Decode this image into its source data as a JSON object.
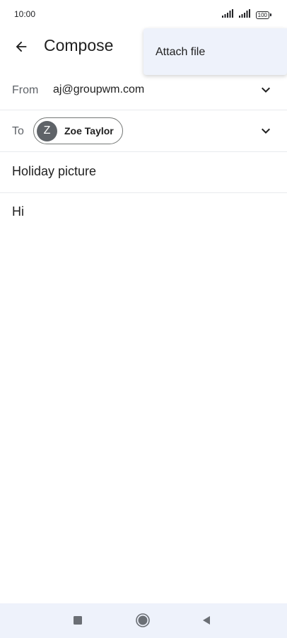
{
  "status_bar": {
    "time": "10:00",
    "battery": "100"
  },
  "app_bar": {
    "title": "Compose",
    "back_icon": "arrow-back-icon"
  },
  "overflow_menu": {
    "items": [
      {
        "label": "Attach file"
      }
    ]
  },
  "from_field": {
    "label": "From",
    "value": "aj@groupwm.com"
  },
  "to_field": {
    "label": "To",
    "recipients": [
      {
        "initial": "Z",
        "name": "Zoe Taylor"
      }
    ]
  },
  "subject": {
    "value": "Holiday picture"
  },
  "body": {
    "value": "Hi"
  },
  "colors": {
    "menu_background": "#eef2fb",
    "avatar_background": "#5f6368",
    "nav_background": "#eef2fb"
  }
}
